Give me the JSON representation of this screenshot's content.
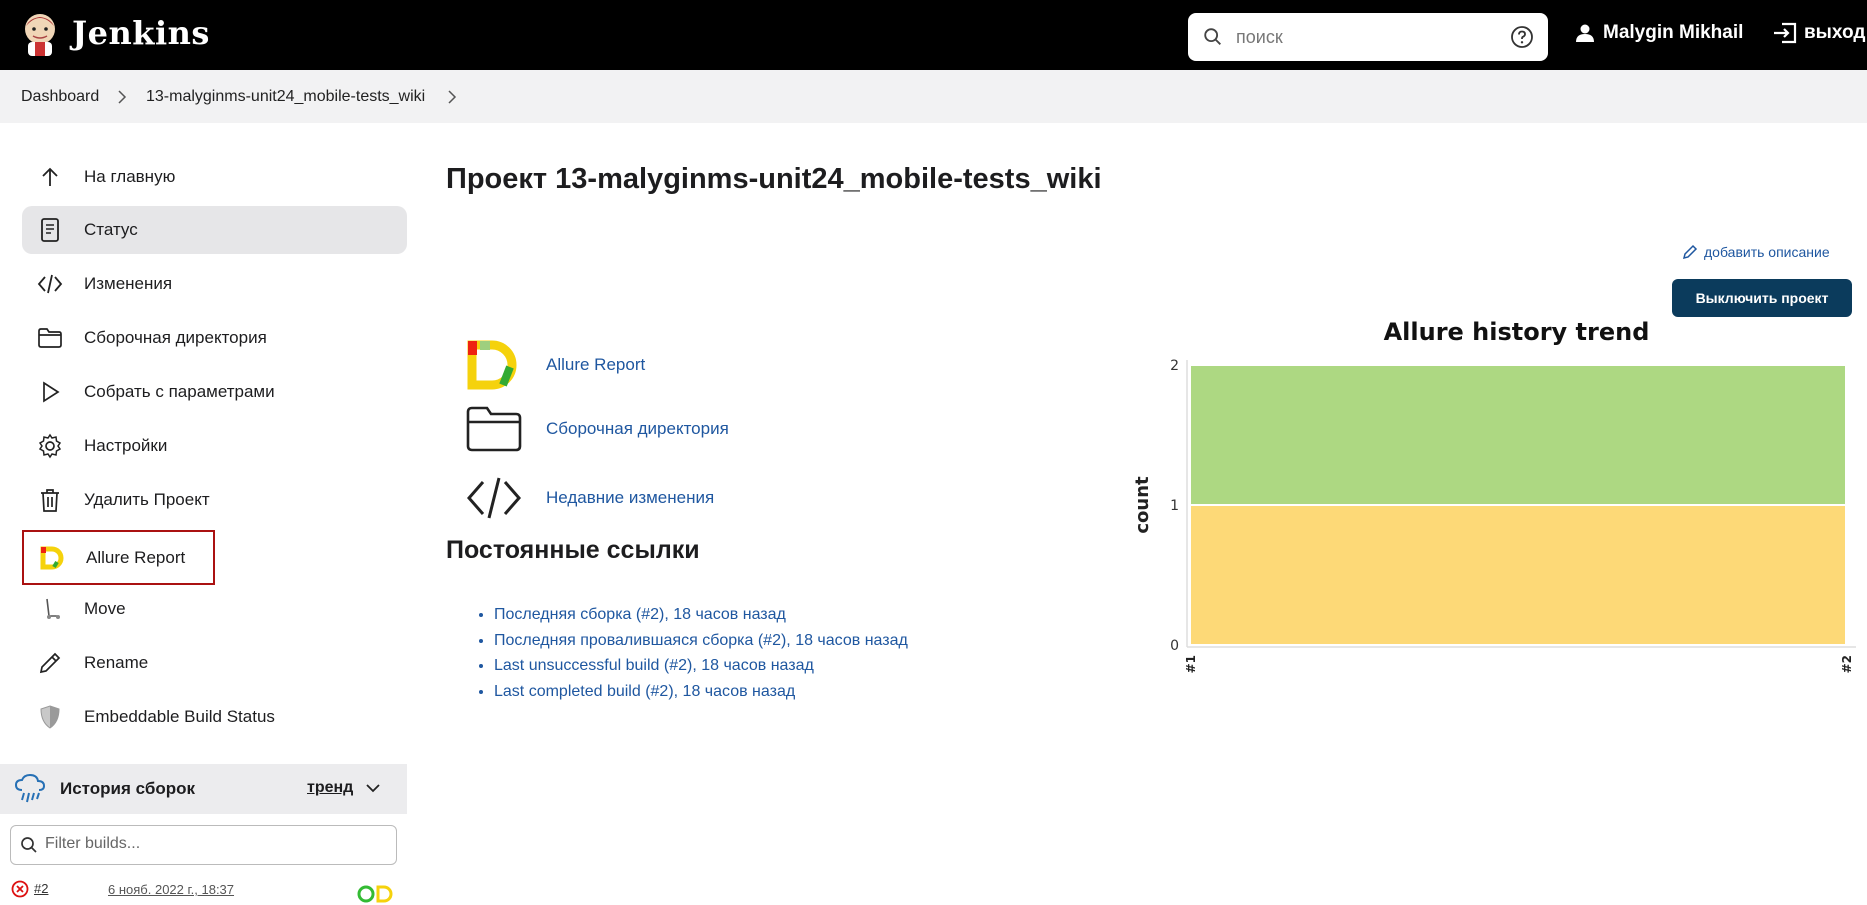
{
  "header": {
    "brand": "Jenkins",
    "search_placeholder": "поиск",
    "user_name": "Malygin Mikhail",
    "logout_label": "выход"
  },
  "breadcrumb": [
    {
      "label": "Dashboard"
    },
    {
      "label": "13-malyginms-unit24_mobile-tests_wiki"
    }
  ],
  "sidebar": {
    "items": [
      {
        "label": "На главную",
        "icon": "arrow-up-icon"
      },
      {
        "label": "Статус",
        "icon": "document-icon"
      },
      {
        "label": "Изменения",
        "icon": "code-icon"
      },
      {
        "label": "Сборочная директория",
        "icon": "folder-icon"
      },
      {
        "label": "Собрать с параметрами",
        "icon": "play-icon"
      },
      {
        "label": "Настройки",
        "icon": "gear-icon"
      },
      {
        "label": "Удалить Проект",
        "icon": "trash-icon"
      },
      {
        "label": "Allure Report",
        "icon": "allure-icon"
      },
      {
        "label": "Move",
        "icon": "scooter-icon"
      },
      {
        "label": "Rename",
        "icon": "pencil-icon"
      },
      {
        "label": "Embeddable Build Status",
        "icon": "shield-icon"
      }
    ],
    "active_index": 1,
    "highlighted_index": 7
  },
  "build_history": {
    "title": "История сборок",
    "trend_label": "тренд",
    "filter_placeholder": "Filter builds...",
    "builds": [
      {
        "number": "#2",
        "date": "6 нояб. 2022 г., 18:37",
        "status": "failed"
      }
    ]
  },
  "main": {
    "title": "Проект 13-malyginms-unit24_mobile-tests_wiki",
    "add_description": "добавить описание",
    "disable_button": "Выключить проект",
    "links": [
      {
        "label": "Allure Report",
        "icon": "allure-icon"
      },
      {
        "label": "Сборочная директория",
        "icon": "folder-icon"
      },
      {
        "label": "Недавние изменения",
        "icon": "code-icon"
      }
    ],
    "permalinks_title": "Постоянные ссылки",
    "permalinks": [
      "Последняя сборка (#2), 18 часов назад",
      "Последняя провалившаяся сборка (#2), 18 часов назад",
      "Last unsuccessful build (#2), 18 часов назад",
      "Last completed build (#2), 18 часов назад"
    ]
  },
  "chart_data": {
    "type": "area",
    "title": "Allure history trend",
    "ylabel": "count",
    "xlabel": "",
    "x": [
      "#1",
      "#2"
    ],
    "ylim": [
      0,
      2
    ],
    "yticks": [
      0,
      1,
      2
    ],
    "series": [
      {
        "name": "",
        "color": "#fdd977",
        "values": [
          1,
          1
        ]
      },
      {
        "name": "",
        "color": "#add882",
        "values": [
          1,
          1
        ]
      }
    ],
    "grid": false,
    "stacked": true
  },
  "colors": {
    "header_bg": "#000000",
    "link": "#1f57a0",
    "primary_button": "#0b3b5c",
    "highlight_border": "#aa1111"
  }
}
